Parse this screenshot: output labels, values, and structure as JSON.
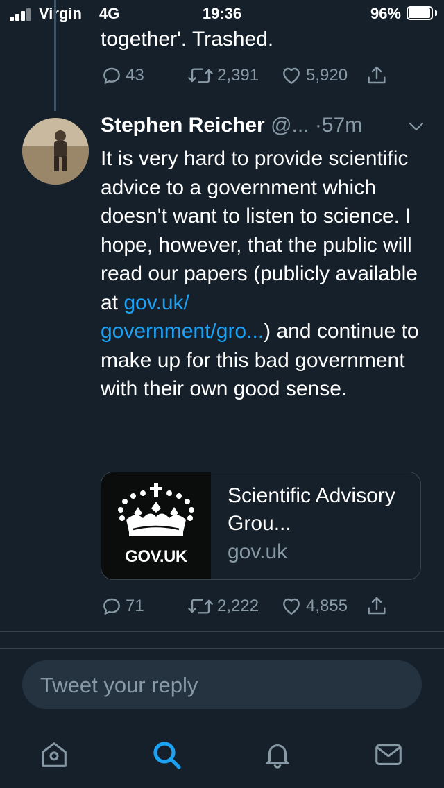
{
  "status_bar": {
    "carrier": "Virgin",
    "network": "4G",
    "time": "19:36",
    "battery_percent": "96%",
    "battery_level": 0.96,
    "signal_bars": 3
  },
  "previous_tweet": {
    "text_tail": "together'. Trashed.",
    "replies": "43",
    "retweets": "2,391",
    "likes": "5,920"
  },
  "tweet": {
    "author_name": "Stephen Reicher",
    "handle": "@...",
    "time": "·57m",
    "text_part1": "It is very hard to provide scientific advice to a government which doesn't want to listen to science. I hope, however, that the public will read our papers (publicly available at ",
    "link_text": "gov.uk/\ngovernment/gro...",
    "text_part2": ") and continue to make up for this bad  government with their own good sense.",
    "card": {
      "image_label": "GOV.UK",
      "title": "Scientific Advisory Grou...",
      "domain": "gov.uk"
    },
    "replies": "71",
    "retweets": "2,222",
    "likes": "4,855"
  },
  "reply_box": {
    "placeholder": "Tweet your reply"
  },
  "tab_bar": {
    "items": [
      "home-icon",
      "search-icon",
      "notifications-icon",
      "messages-icon"
    ],
    "active": "search-icon"
  },
  "colors": {
    "background": "#15202b",
    "accent": "#1da1f2",
    "muted": "#8899a6",
    "border": "#38444d"
  }
}
